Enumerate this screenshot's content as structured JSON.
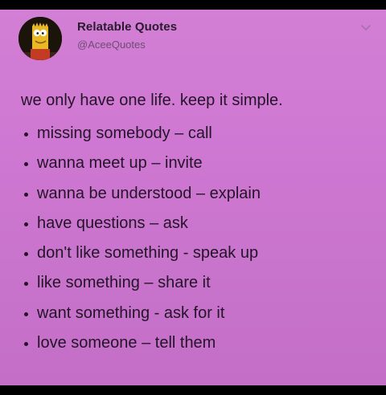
{
  "tweet": {
    "user": {
      "name": "Relatable Quotes",
      "handle": "@AceeQuotes"
    },
    "intro": "we only have one life. keep it simple.",
    "bullets": [
      "missing somebody – call",
      "wanna meet up – invite",
      "wanna be understood – explain",
      "have questions – ask",
      "don't like something - speak up",
      "like something – share it",
      "want something - ask for it",
      "love someone – tell them"
    ]
  },
  "colors": {
    "background": "#cf78d3",
    "text": "#241428",
    "handle": "#6d4e73",
    "frame": "#000000"
  },
  "icons": {
    "avatar": "cartoon-character-avatar",
    "menu": "chevron-down-icon"
  }
}
